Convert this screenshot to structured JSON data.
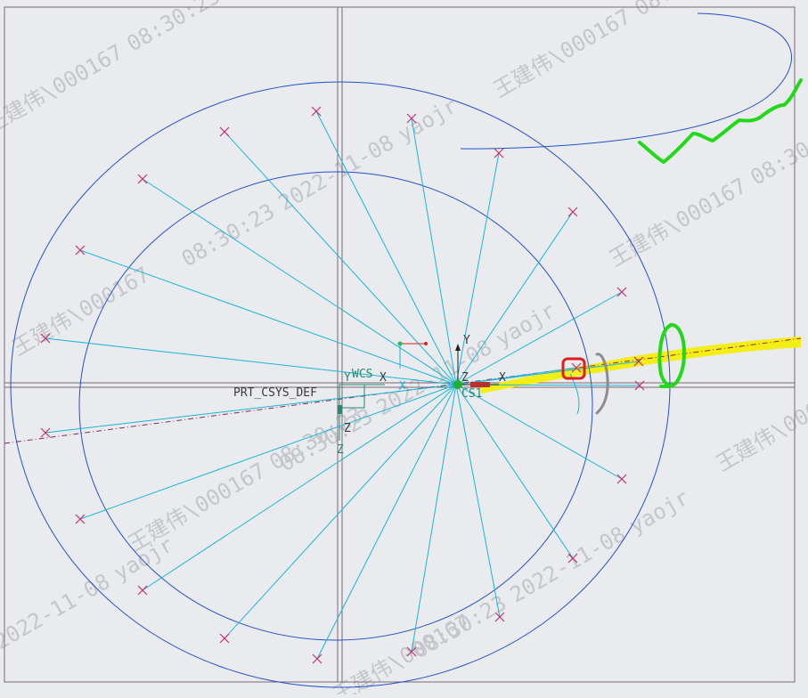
{
  "colors": {
    "background": "#e9ebef",
    "frame": "#7a6a70",
    "circle": "#2451c9",
    "spoke": "#19b5d8",
    "cross": "#c1326e",
    "csys": "#1f8a75",
    "label": "#3a3a3a",
    "highlight_yellow": "#f4ee14",
    "annotation_green": "#22d81a",
    "annotation_red": "#e01c1c",
    "annotation_gray": "#8c8c8c",
    "watermark": "#c4c6cb"
  },
  "labels": {
    "prt_csys": "PRT_CSYS_DEF",
    "wcs": "WCS",
    "csys_name": "CS1",
    "axis_x": "X",
    "axis_y": "Y",
    "axis_z": "Z"
  },
  "watermark": {
    "name": "王建伟\\000167",
    "time": "08:30:23",
    "date": "2022-11-08",
    "user": "yaojr"
  },
  "icons": {
    "point_marker": "x-cross-icon",
    "csys": "coordinate-system-icon",
    "wcs": "world-coordinate-system-icon"
  }
}
